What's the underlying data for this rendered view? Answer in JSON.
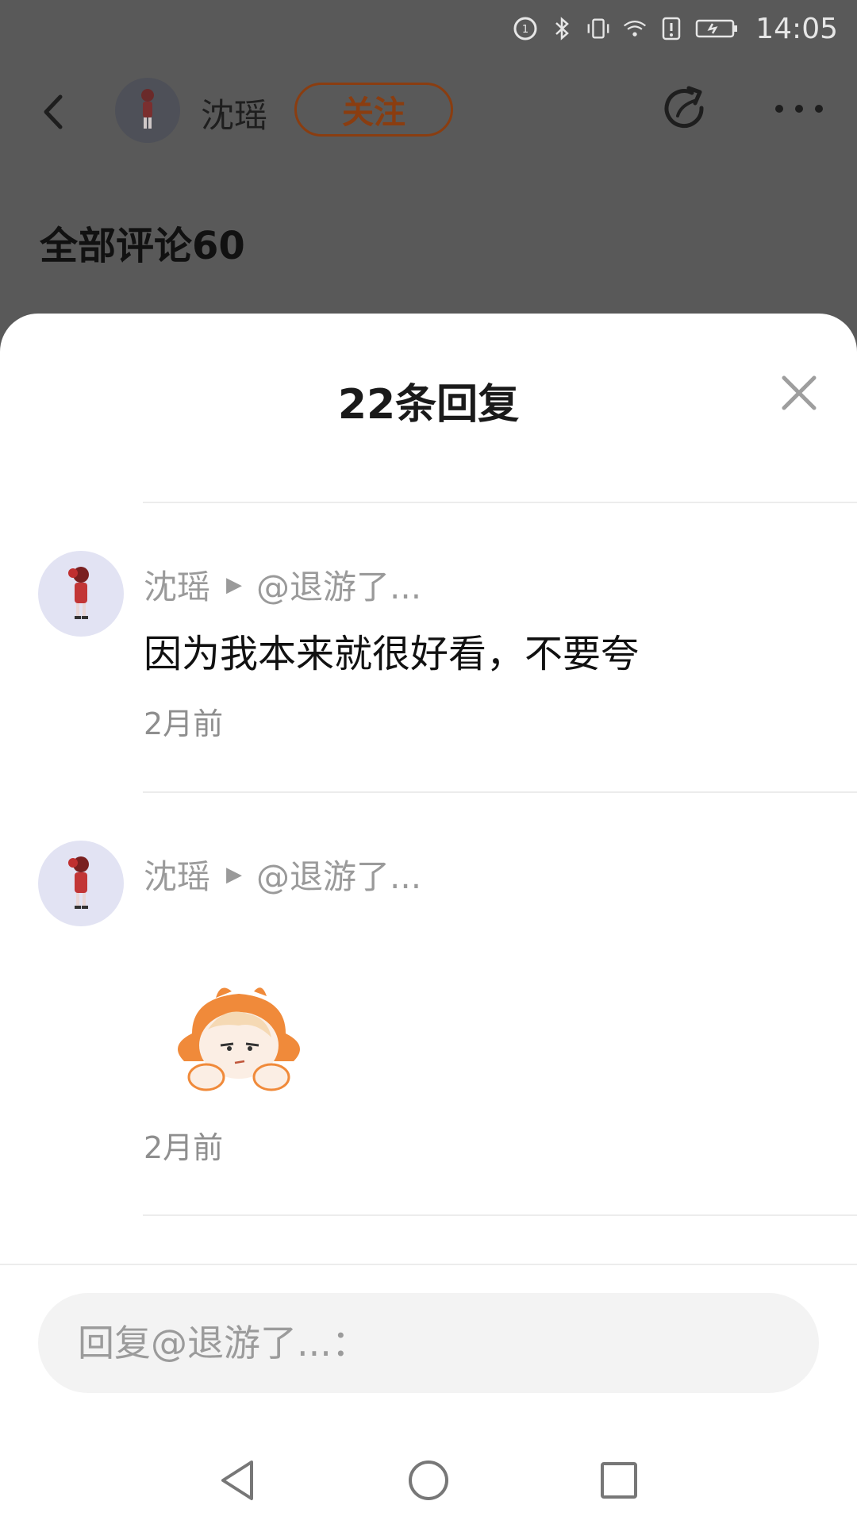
{
  "status_bar": {
    "time": "14:05",
    "icons": [
      "hd-call-icon",
      "bluetooth-icon",
      "vibrate-icon",
      "wifi-icon",
      "alert-icon",
      "battery-charging-icon"
    ]
  },
  "header": {
    "user_name": "沈瑶",
    "follow_label": "关注",
    "icons": [
      "back-icon",
      "share-icon",
      "more-icon"
    ]
  },
  "page": {
    "comments_title": "全部评论60"
  },
  "sheet": {
    "title": "22条回复",
    "replies": [
      {
        "author": "沈瑶",
        "reply_to": "@退游了...",
        "text": "因为我本来就很好看，不要夸",
        "time": "2月前"
      },
      {
        "author": "沈瑶",
        "reply_to": "@退游了...",
        "sticker": "grumpy-orange-hair-girl-sticker",
        "time": "2月前"
      }
    ],
    "input": {
      "placeholder": "回复@退游了...："
    }
  },
  "system_nav": {
    "icons": [
      "nav-back-icon",
      "nav-home-icon",
      "nav-recents-icon"
    ]
  },
  "colors": {
    "overlay": "#595959",
    "follow": "#8a3d10",
    "sheet_bg": "#ffffff",
    "muted_text": "#9a9a9a",
    "input_bg": "#f3f3f3"
  }
}
